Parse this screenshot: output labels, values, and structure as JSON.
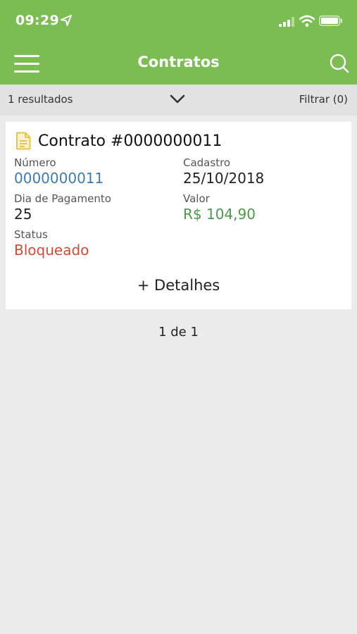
{
  "status_bar": {
    "time": "09:29"
  },
  "nav": {
    "title": "Contratos"
  },
  "results": {
    "count_label": "1 resultados",
    "filter_label": "Filtrar (0)"
  },
  "contract": {
    "title": "Contrato #0000000011",
    "numero_label": "Número",
    "numero_value": "0000000011",
    "cadastro_label": "Cadastro",
    "cadastro_value": "25/10/2018",
    "dia_label": "Dia de Pagamento",
    "dia_value": "25",
    "valor_label": "Valor",
    "valor_value": "R$ 104,90",
    "status_label": "Status",
    "status_value": "Bloqueado",
    "details_label": "+ Detalhes"
  },
  "pagination": {
    "label": "1 de 1"
  },
  "colors": {
    "header": "#7bbd52",
    "numero": "#3f7ab3",
    "valor": "#4a9a4a",
    "status": "#d24a3a",
    "doc_icon": "#e8c44a"
  }
}
